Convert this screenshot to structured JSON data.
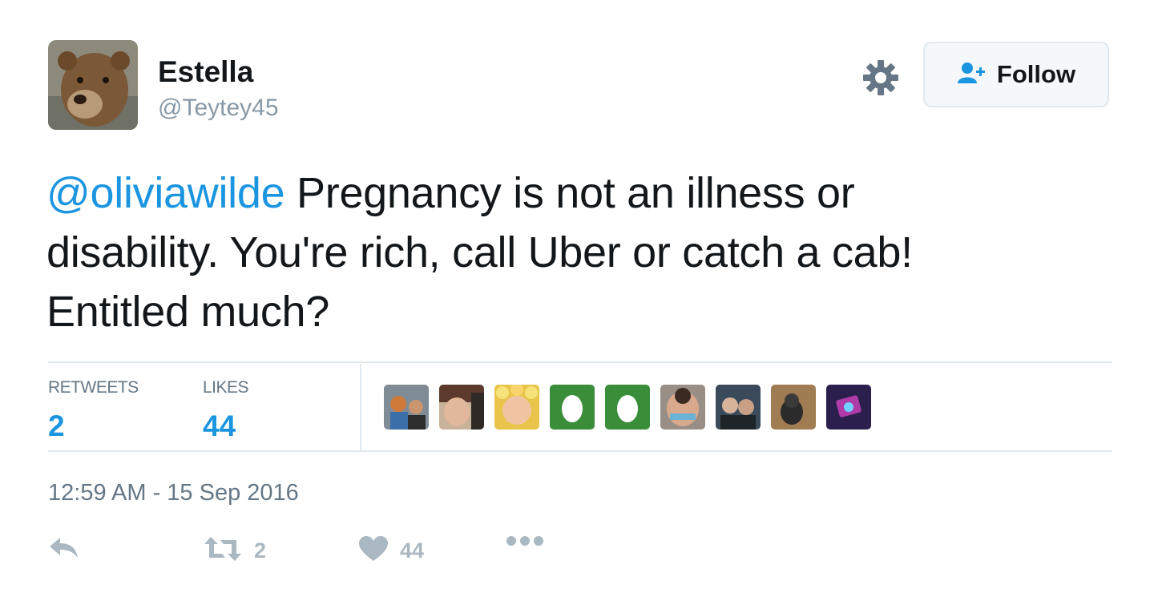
{
  "user": {
    "name": "Estella",
    "handle": "@Teytey45",
    "avatar_icon": "bear-photo"
  },
  "header": {
    "settings_icon": "gear-icon",
    "follow_label": "Follow",
    "follow_icon": "add-user-icon"
  },
  "tweet": {
    "mention": "@oliviawilde",
    "line1_rest": " Pregnancy is not an illness or",
    "line2": "disability.  You're rich, call Uber or catch a cab!",
    "line3": "Entitled much?"
  },
  "stats": {
    "retweets_label": "RETWEETS",
    "retweets_value": "2",
    "likes_label": "LIKES",
    "likes_value": "44"
  },
  "likers": [
    "photo",
    "photo",
    "photo",
    "default-egg",
    "default-egg",
    "photo",
    "photo",
    "photo",
    "photo"
  ],
  "timestamp": "12:59 AM - 15 Sep 2016",
  "actions": {
    "reply_icon": "reply-icon",
    "retweet_count": "2",
    "like_count": "44",
    "more_icon": "more-dots-icon"
  },
  "colors": {
    "link": "#1b95e0",
    "muted": "#657786",
    "border": "#e1e8ed",
    "action": "#aab8c2",
    "egg_green": "#3a8e3a"
  }
}
